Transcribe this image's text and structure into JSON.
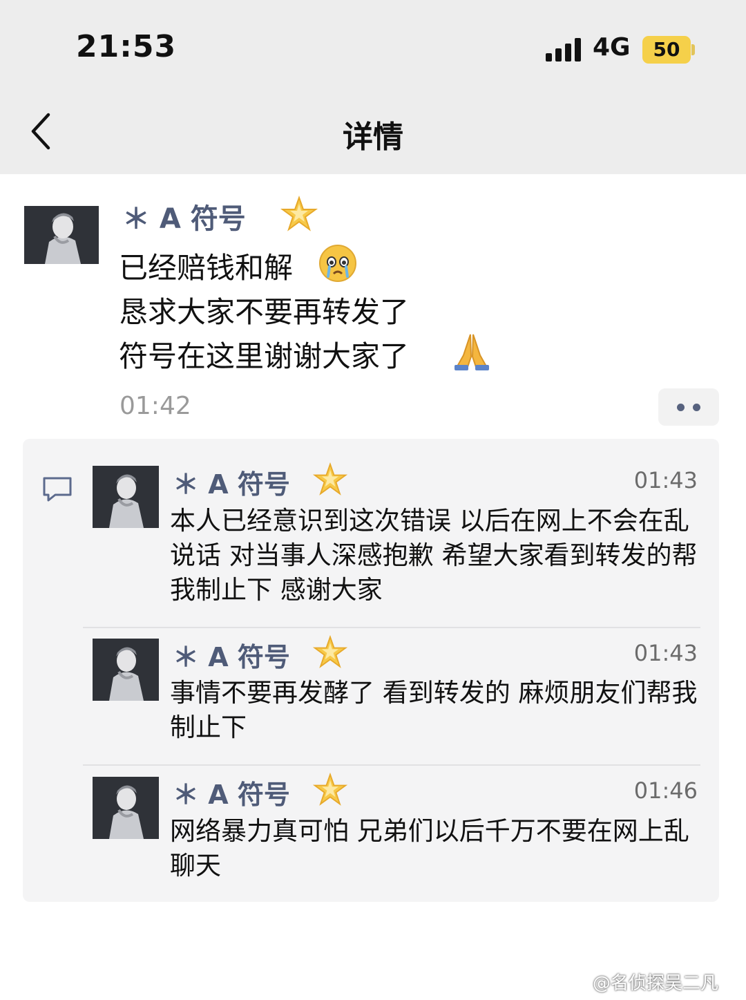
{
  "status_bar": {
    "time": "21:53",
    "network": "4G",
    "battery": "50"
  },
  "nav": {
    "title": "详情",
    "back_icon": "chevron-left-icon"
  },
  "post": {
    "author": "＊  A 符号",
    "author_badge": "glowing-star-emoji",
    "lines": [
      "已经赔钱和解",
      "恳求大家不要再转发了",
      "符号在这里谢谢大家了"
    ],
    "emojis": [
      "crying-face-emoji",
      "folded-hands-emoji"
    ],
    "time": "01:42",
    "more_icon": "more-dots-icon"
  },
  "replies": [
    {
      "author": "＊  A 符号",
      "time": "01:43",
      "text": "本人已经意识到这次错误 以后在网上不会在乱说话 对当事人深感抱歉 希望大家看到转发的帮我制止下 感谢大家"
    },
    {
      "author": "＊  A 符号",
      "time": "01:43",
      "text": "事情不要再发酵了 看到转发的 麻烦朋友们帮我制止下"
    },
    {
      "author": "＊  A 符号",
      "time": "01:46",
      "text": "网络暴力真可怕 兄弟们以后千万不要在网上乱聊天"
    }
  ],
  "watermark": "@名侦探吴二凡",
  "colors": {
    "header_bg": "#ededed",
    "name_color": "#4f5b78",
    "battery": "#f5d04a",
    "reply_bg": "#f4f4f5"
  }
}
